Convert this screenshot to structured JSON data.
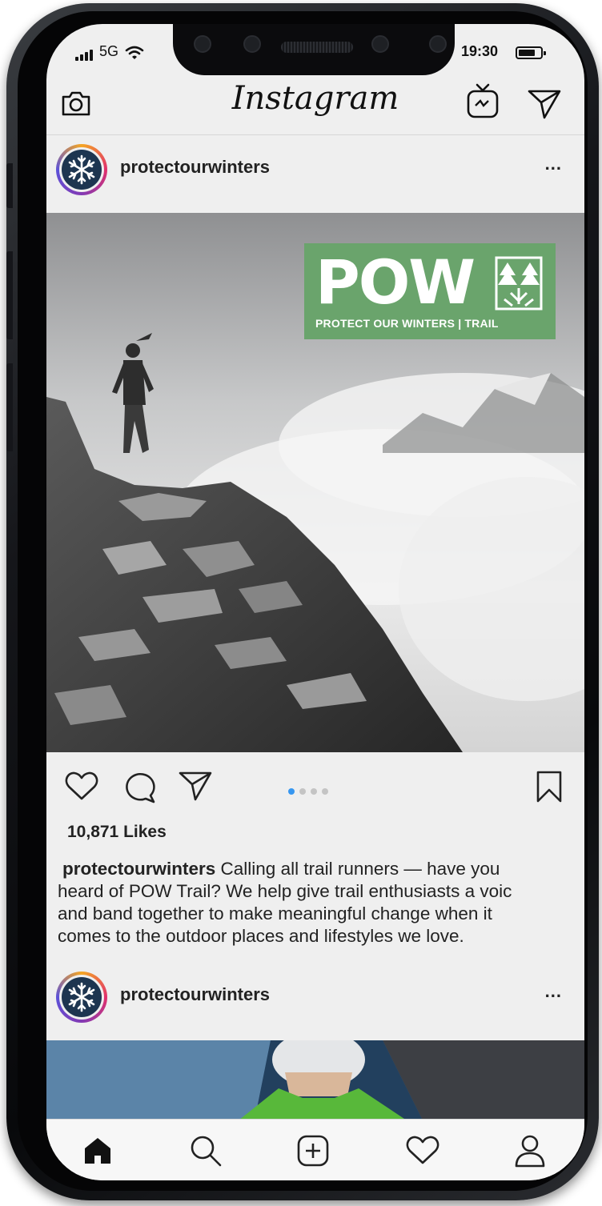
{
  "status_bar": {
    "network": "5G",
    "time": "19:30"
  },
  "header": {
    "brand": "Instagram",
    "left_icon": "camera-icon",
    "right_icons": [
      "igtv-icon",
      "direct-message-icon"
    ]
  },
  "posts": [
    {
      "username": "protectourwinters",
      "more_label": "...",
      "image_badge": {
        "title": "POW",
        "subtitle": "PROTECT OUR WINTERS | TRAIL",
        "color": "#6aa46c"
      },
      "carousel": {
        "count": 4,
        "active": 1
      },
      "actions": [
        "heart-icon",
        "comment-icon",
        "share-icon",
        "bookmark-icon"
      ],
      "likes": "10,871 Likes",
      "caption_user": "protectourwinters",
      "caption_lines": [
        " Calling all trail runners — have you",
        "heard of POW Trail? We help give trail enthusiasts a voic",
        "and band together to make meaningful change when it",
        "comes to the outdoor places and lifestyles we love."
      ]
    },
    {
      "username": "protectourwinters",
      "more_label": "..."
    }
  ],
  "tab_bar": [
    "home-icon",
    "search-icon",
    "new-post-icon",
    "activity-icon",
    "profile-icon"
  ],
  "colors": {
    "accent_blue": "#3797f0",
    "pow_green": "#6aa46c",
    "avatar_navy": "#1d3550"
  }
}
